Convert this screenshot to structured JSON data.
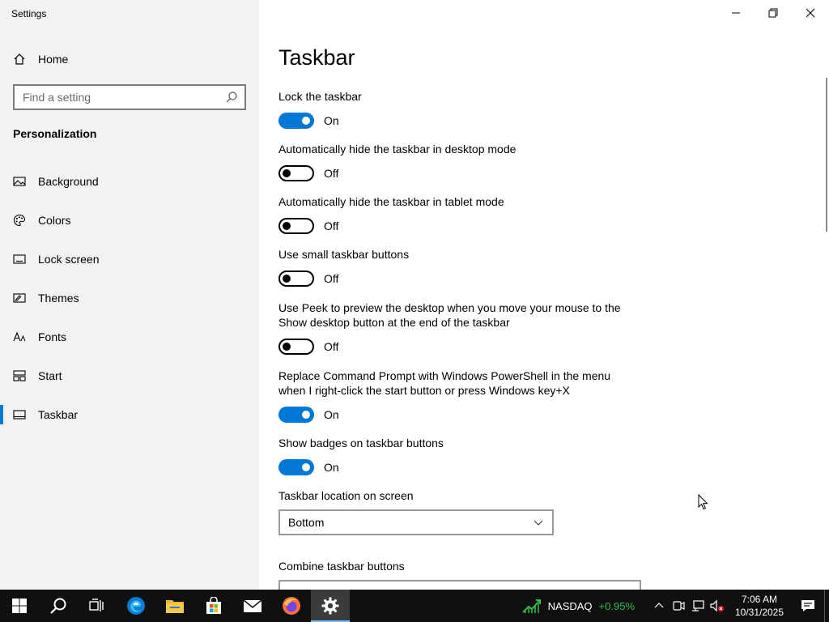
{
  "window": {
    "title": "Settings"
  },
  "sidebar": {
    "home_label": "Home",
    "search_placeholder": "Find a setting",
    "section": "Personalization",
    "items": [
      {
        "label": "Background",
        "icon": "picture-icon"
      },
      {
        "label": "Colors",
        "icon": "palette-icon"
      },
      {
        "label": "Lock screen",
        "icon": "lock-screen-icon"
      },
      {
        "label": "Themes",
        "icon": "themes-icon"
      },
      {
        "label": "Fonts",
        "icon": "fonts-icon"
      },
      {
        "label": "Start",
        "icon": "start-icon"
      },
      {
        "label": "Taskbar",
        "icon": "taskbar-icon",
        "selected": true
      }
    ]
  },
  "main": {
    "title": "Taskbar",
    "settings": [
      {
        "label": "Lock the taskbar",
        "state": "On"
      },
      {
        "label": "Automatically hide the taskbar in desktop mode",
        "state": "Off"
      },
      {
        "label": "Automatically hide the taskbar in tablet mode",
        "state": "Off"
      },
      {
        "label": "Use small taskbar buttons",
        "state": "Off"
      },
      {
        "label": "Use Peek to preview the desktop when you move your mouse to the Show desktop button at the end of the taskbar",
        "state": "Off"
      },
      {
        "label": "Replace Command Prompt with Windows PowerShell in the menu when I right-click the start button or press Windows key+X",
        "state": "On"
      },
      {
        "label": "Show badges on taskbar buttons",
        "state": "On"
      }
    ],
    "location_label": "Taskbar location on screen",
    "location_value": "Bottom",
    "combine_label": "Combine taskbar buttons"
  },
  "taskbar": {
    "stock_name": "NASDAQ",
    "stock_change": "+0.95%",
    "time": "7:06 AM",
    "date": "10/31/2025"
  },
  "colors": {
    "accent": "#0078d7",
    "sidebar_bg": "#f2f2f2",
    "taskbar_bg": "#101010",
    "stock_up": "#2fbf4a"
  }
}
